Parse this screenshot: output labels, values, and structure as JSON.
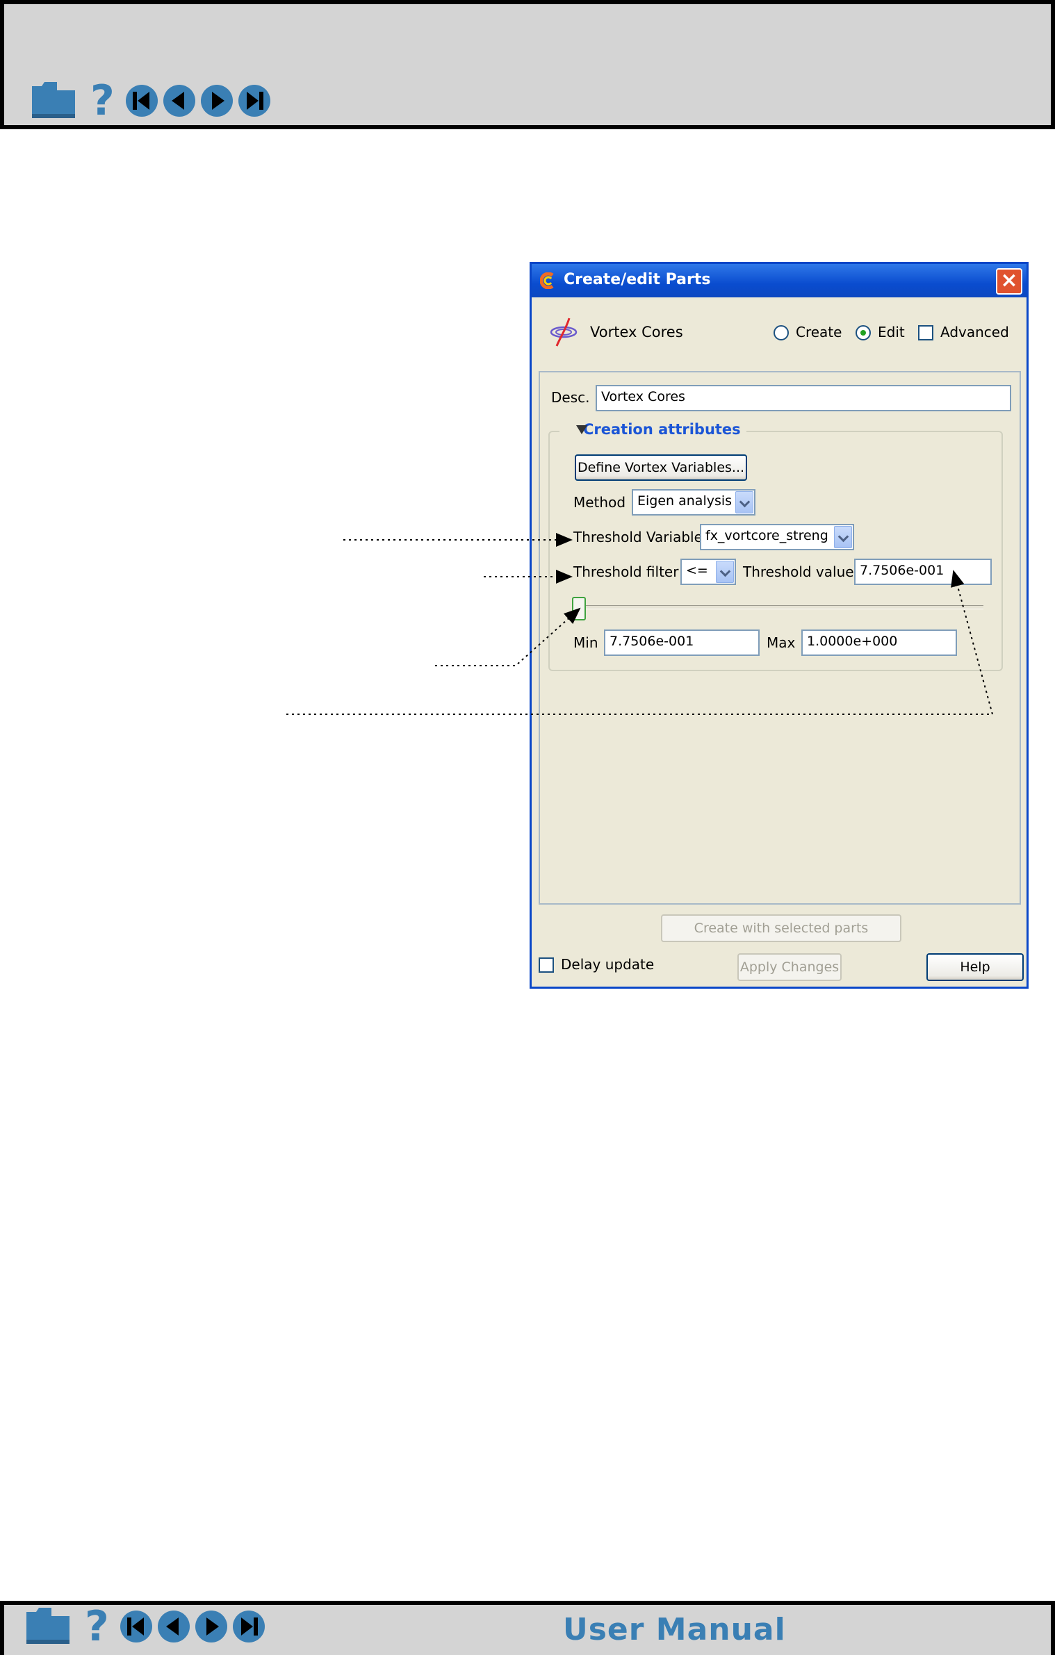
{
  "header": {
    "nav_icons": [
      "home-icon",
      "help-icon",
      "first-page-icon",
      "previous-page-icon",
      "next-page-icon",
      "last-page-icon"
    ],
    "help_glyph": "?"
  },
  "footer": {
    "title": "User Manual",
    "help_glyph": "?"
  },
  "colors": {
    "nav_blue": "#3a7fb4",
    "titlebar_blue": "#0a4ccf",
    "group_title_blue": "#1b55d6"
  },
  "dialog": {
    "title": "Create/edit Parts",
    "close_glyph": "×",
    "part_type": "Vortex Cores",
    "mode_options": [
      {
        "label": "Create",
        "selected": false
      },
      {
        "label": "Edit",
        "selected": true
      }
    ],
    "advanced": {
      "label": "Advanced",
      "checked": false
    },
    "desc_label": "Desc.",
    "desc_value": "Vortex Cores",
    "creation_attributes": {
      "title": "Creation attributes",
      "define_button": "Define Vortex Variables...",
      "method_label": "Method",
      "method_value": "Eigen analysis",
      "threshold_variable_label": "Threshold Variable",
      "threshold_variable_value": "fx_vortcore_streng",
      "threshold_filter_label": "Threshold filter",
      "threshold_filter_value": "<=",
      "threshold_value_label": "Threshold value",
      "threshold_value": "7.7506e-001",
      "slider_fraction": 0.0,
      "min_label": "Min",
      "min_value": "7.7506e-001",
      "max_label": "Max",
      "max_value": "1.0000e+000"
    },
    "create_button": "Create with selected parts",
    "delay_update": {
      "label": "Delay update",
      "checked": false
    },
    "apply_button": "Apply Changes",
    "help_button": "Help"
  }
}
